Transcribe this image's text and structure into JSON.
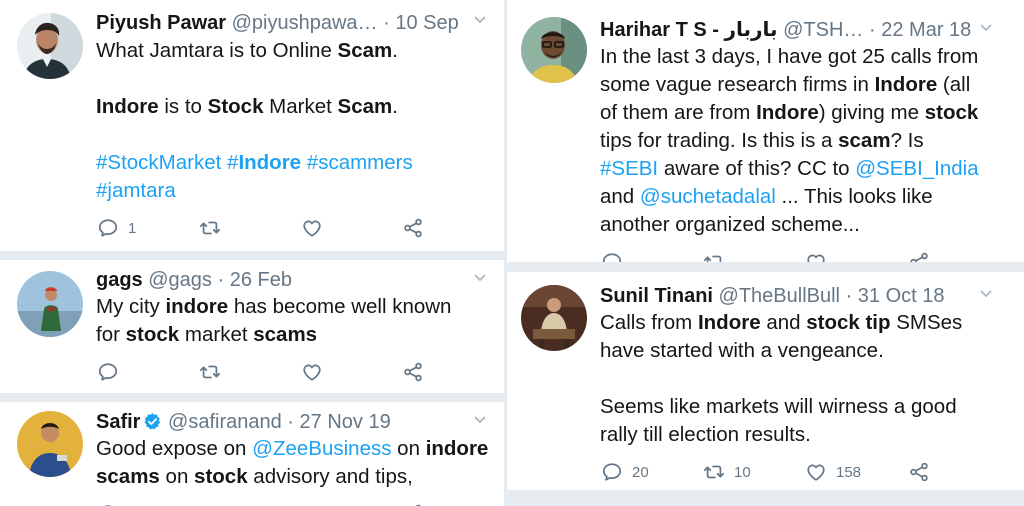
{
  "colors": {
    "link": "#1da1f2",
    "muted": "#657786",
    "separator": "#e6ecf0",
    "verified": "#1da1f2"
  },
  "icons": [
    "reply-icon",
    "retweet-icon",
    "like-icon",
    "share-icon",
    "chevron-down-icon",
    "verified-icon"
  ],
  "left": {
    "tweets": [
      {
        "name": "Piyush Pawar",
        "handle": "@piyushpawa…",
        "dot": "·",
        "date": "10 Sep",
        "body": {
          "l1a": "What Jamtara is to Online ",
          "l1b": "Scam",
          "l1c": ".",
          "l2a": "Indore",
          "l2b": " is to ",
          "l2c": "Stock",
          "l2d": " Market ",
          "l2e": "Scam",
          "l2f": ".",
          "l3a": "#StockMarket",
          "l3b": " ",
          "l3c": "#",
          "l3d": "Indore",
          "l3e": " ",
          "l3f": "#scammers",
          "l4": "#jamtara"
        },
        "reply_count": "1"
      },
      {
        "name": "gags",
        "handle": "@gags",
        "dot": "·",
        "date": "26 Feb",
        "body": {
          "a": "My city ",
          "b": "indore",
          "c": " has become well known",
          "d": "for ",
          "e": "stock",
          "f": " market ",
          "g": "scams"
        }
      },
      {
        "name": "Safir",
        "handle": "@safiranand",
        "dot": "·",
        "date": "27 Nov 19",
        "body": {
          "a": "Good expose on ",
          "b": "@ZeeBusiness",
          "c": " on ",
          "d": "indore",
          "e": "scams",
          "f": " on ",
          "g": "stock",
          "h": " advisory and tips,"
        }
      }
    ]
  },
  "right": {
    "tweets": [
      {
        "name": "Harihar T S - باربار",
        "handle": "@TSH…",
        "dot": "·",
        "date": "22 Mar 18",
        "body": {
          "a": "In the last 3 days, I have got 25 calls from",
          "b": "some vague research firms in ",
          "c": "Indore",
          "d": " (all",
          "e": "of them are from ",
          "f": "Indore",
          "g": ") giving me ",
          "h": "stock",
          "i": "tips for trading. Is this is a ",
          "j": "scam",
          "k": "? Is",
          "l": "#SEBI",
          "m": " aware of this? CC to ",
          "n": "@SEBI_India",
          "o": "and ",
          "p": "@suchetadalal",
          "q": " ... This looks like",
          "r": "another organized scheme..."
        }
      },
      {
        "name": "Sunil Tinani",
        "handle": "@TheBullBull",
        "dot": "·",
        "date": "31 Oct 18",
        "body": {
          "a": "Calls from ",
          "b": "Indore",
          "c": " and ",
          "d": "stock tip",
          "e": " SMSes",
          "f": "have started with a vengeance.",
          "g": "Seems like markets will wirness a good",
          "h": "rally till election results."
        },
        "reply_count": "20",
        "retweet_count": "10",
        "like_count": "158"
      }
    ]
  }
}
